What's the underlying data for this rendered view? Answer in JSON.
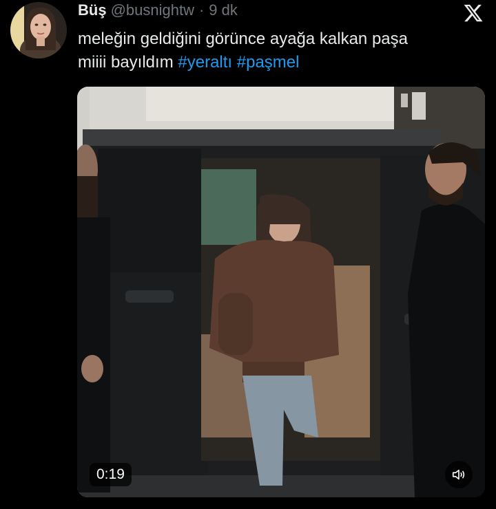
{
  "tweet": {
    "author_name": "Büş",
    "handle": "@busnightw",
    "separator": "·",
    "time": "9 dk",
    "text_line1": "meleğin geldiğini görünce ayağa kalkan paşa",
    "text_line2_prefix": "miiii bayıldım",
    "hashtags": [
      "#yeraltı",
      "#paşmel"
    ]
  },
  "video": {
    "timestamp": "0:19",
    "volume_icon": "speaker-muted-icon"
  },
  "icons": {
    "platform_logo": "x-logo-icon"
  },
  "colors": {
    "background": "#000000",
    "text_primary": "#e7e9ea",
    "text_secondary": "#71767b",
    "hashtag": "#1d9bf0"
  }
}
